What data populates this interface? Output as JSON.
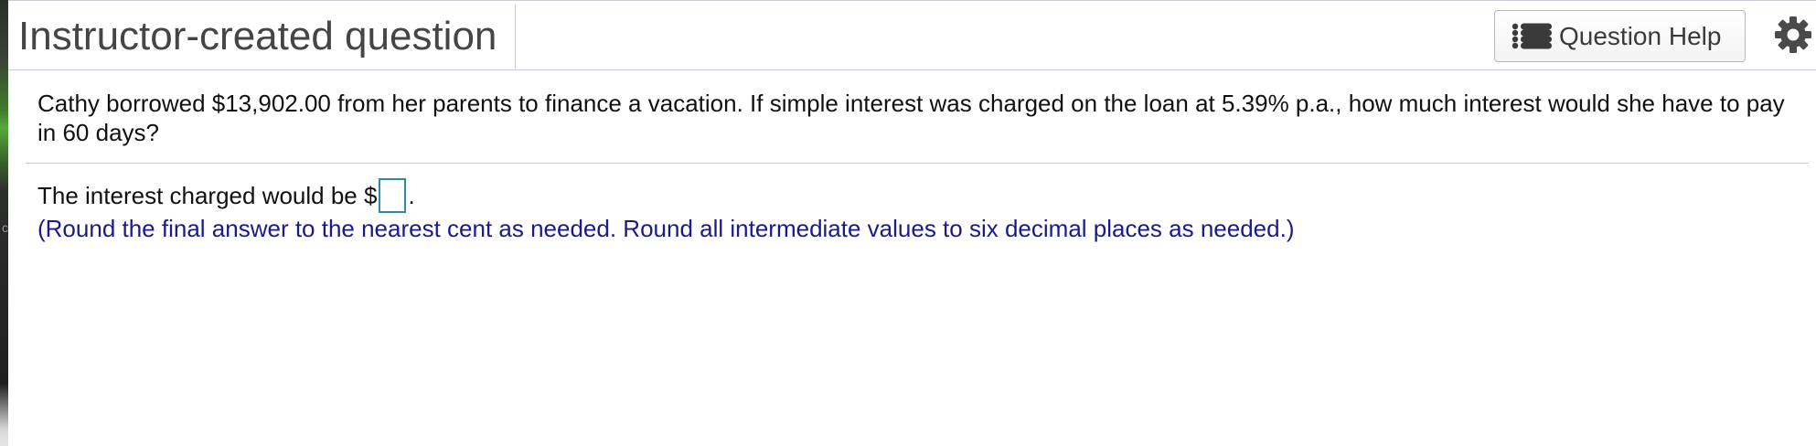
{
  "header": {
    "title": "Instructor-created question",
    "help_button_label": "Question Help",
    "help_icon": "list-icon",
    "settings_icon": "gear-icon"
  },
  "question": {
    "text": "Cathy borrowed $13,902.00 from her parents to finance a vacation. If simple interest was charged on the loan at 5.39% p.a., how much interest would she have to pay in 60 days?"
  },
  "answer": {
    "prefix": "The interest charged would be $",
    "input_value": "",
    "suffix": "."
  },
  "hint": "(Round the final answer to the nearest cent as needed. Round all intermediate values to six decimal places as needed.)",
  "colors": {
    "hint_text": "#1a1a8c",
    "input_border": "#2f8aa6",
    "title_text": "#454545"
  }
}
